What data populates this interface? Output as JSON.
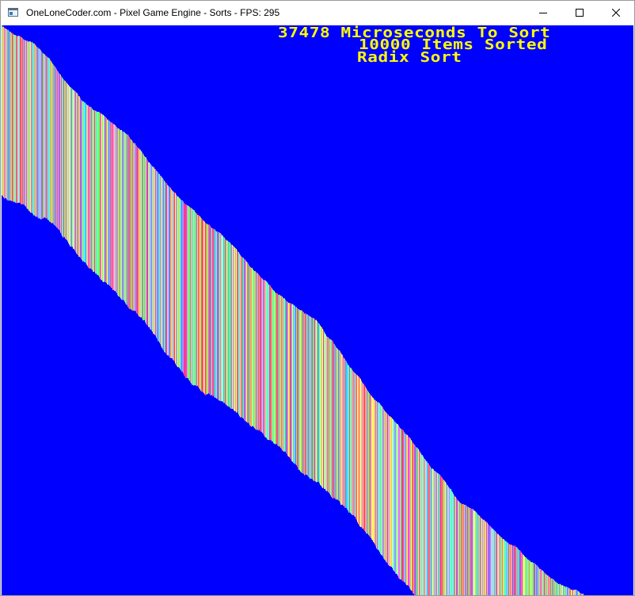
{
  "window": {
    "title": "OneLoneCoder.com - Pixel Game Engine - Sorts - FPS: 295",
    "controls": {
      "minimize_icon": "minimize-icon",
      "maximize_icon": "maximize-icon",
      "close_icon": "close-icon"
    }
  },
  "hud": {
    "line1": "37478 Microseconds To Sort",
    "line2": "10000 Items Sorted",
    "line3": "Radix Sort"
  },
  "colors": {
    "background": "#0000ff",
    "hud_text": "#ffff00",
    "bar_palette": [
      "#ff6666",
      "#66ff66",
      "#ffff66",
      "#66ffff",
      "#ff66ff",
      "#9966ff",
      "#ff9966",
      "#66ff99",
      "#ffcc66",
      "#cccccc",
      "#ff3399",
      "#33ccff"
    ]
  }
}
